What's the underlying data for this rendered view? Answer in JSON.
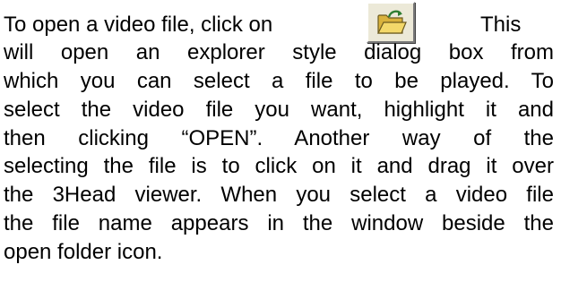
{
  "paragraph": {
    "lead": "To open a video file, click on",
    "after_icon": "This",
    "lines": [
      "will open an explorer style dialog box from",
      "which you can select a file to be played. To",
      "select the video file you want, highlight it and",
      "then clicking “OPEN”. Another way of the",
      "selecting the file is to click on it and drag it over",
      "the 3Head viewer. When you select a video file",
      "the file name appears in the window beside the",
      "open folder icon."
    ]
  },
  "icon": {
    "name": "open-folder-icon",
    "folder_color": "#e8c547",
    "arrow_color": "#2e7d32"
  }
}
